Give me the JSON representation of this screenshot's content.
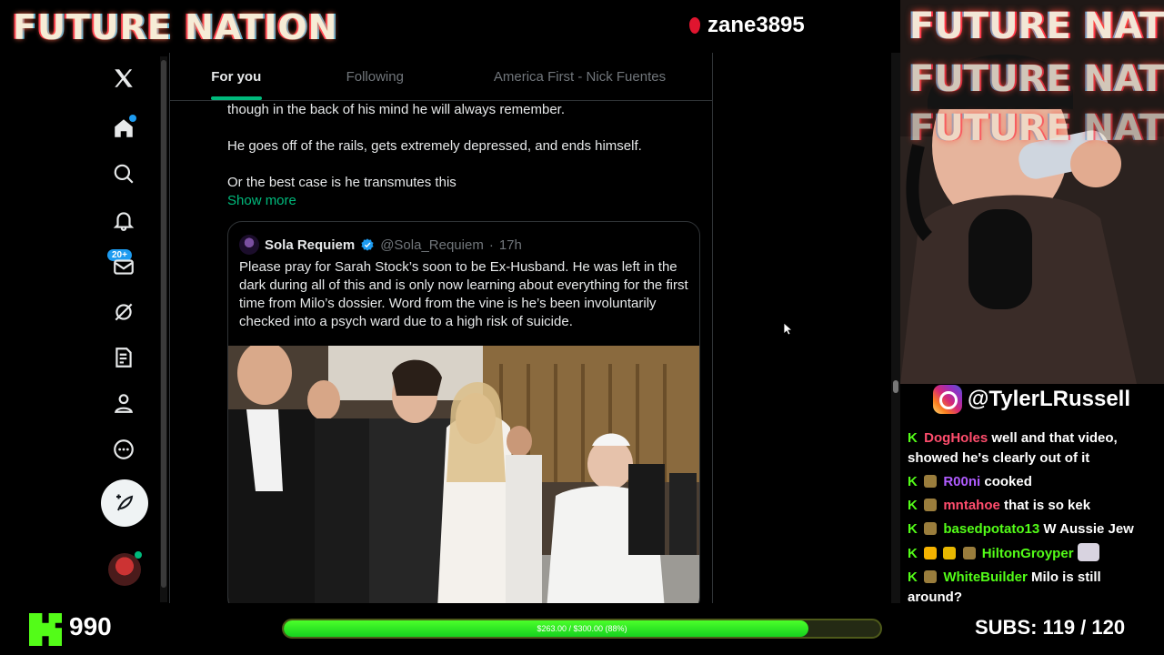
{
  "header": {
    "brand": "FUTURE NATION",
    "kick_handle": "zane3895"
  },
  "nav": {
    "items": [
      "x-logo",
      "home",
      "explore",
      "notifications",
      "messages",
      "grok",
      "lists",
      "profile",
      "more"
    ],
    "messages_badge": "20+"
  },
  "tabs": [
    {
      "label": "For you",
      "active": true
    },
    {
      "label": "Following",
      "active": false
    },
    {
      "label": "America First - Nick Fuentes",
      "active": false
    }
  ],
  "tweet": {
    "lines": [
      "though in the back of his mind he will always remember.",
      "He goes off of the rails, gets extremely depressed, and ends himself.",
      "Or the best case is he transmutes this"
    ],
    "show_more": "Show more",
    "quote": {
      "name": "Sola Requiem",
      "handle": "@Sola_Requiem",
      "dot": "·",
      "time": "17h",
      "text": "Please pray for Sarah Stock’s soon to be Ex-Husband. He was left in the dark during all of this and is only now learning about everything for the first time from Milo’s dossier. Word from the vine is he’s been involuntarily checked into a psych ward due to a high risk of suicide."
    }
  },
  "stream": {
    "cam_title": "FUTURE NATION",
    "instagram": "@TylerLRussell",
    "chat": [
      {
        "user": "DogHoles",
        "color": "#ff4d6d",
        "badge": false,
        "text": "well and that video, showed he's clearly out of it"
      },
      {
        "user": "R00ni",
        "color": "#b05cff",
        "badge": true,
        "text": "cooked"
      },
      {
        "user": "mntahoe",
        "color": "#ff4d6d",
        "badge": true,
        "text": "that is so kek"
      },
      {
        "user": "basedpotato13",
        "color": "#53fc18",
        "badge": true,
        "text": "W Aussie Jew"
      },
      {
        "user": "HiltonGroyper",
        "color": "#53fc18",
        "badge": true,
        "text": ""
      },
      {
        "user": "WhiteBuilder",
        "color": "#53fc18",
        "badge": true,
        "text": "Milo is still around?"
      }
    ]
  },
  "bottom": {
    "followers": "990",
    "goal_label": "$263.00 / $300.00 (88%)",
    "goal_fraction": 0.88,
    "subs": "SUBS:  119 / 120"
  },
  "colors": {
    "accent_green": "#00ba7c",
    "kick_green": "#53fc18",
    "x_blue": "#1d9bf0"
  }
}
